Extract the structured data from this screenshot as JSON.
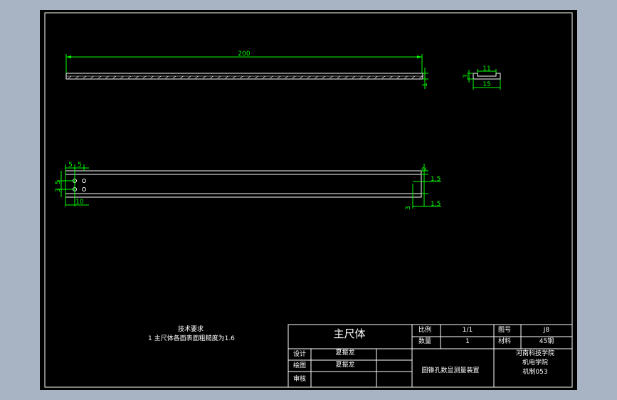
{
  "drawing": {
    "top_view": {
      "length_dim": "200",
      "end_dim": "1"
    },
    "section_view": {
      "width_dim": "15",
      "slot_dim": "11",
      "height_dim": "3"
    },
    "front_view": {
      "left_dims": {
        "top_a": "5",
        "top_b": "5",
        "side_a": "3",
        "side_b": "5",
        "bottom": "10"
      },
      "right_dims": {
        "d1": "2",
        "d2": "1.5",
        "d3": "3",
        "d4": "1.5"
      }
    },
    "notes": {
      "heading": "技术要求",
      "item_1": "1  主尺体各面表面粗糙度为1.6"
    },
    "title_block": {
      "part_name": "主尺体",
      "scale_label": "比例",
      "scale_value": "1/1",
      "drawing_no_label": "图号",
      "drawing_no_value": "J8",
      "qty_label": "数量",
      "qty_value": "1",
      "material_label": "材料",
      "material_value": "45钢",
      "design_label": "设计",
      "design_name": "夏振龙",
      "draw_label": "绘图",
      "draw_name": "夏振龙",
      "review_label": "审核",
      "assembly_name": "圆锥孔数显测量装置",
      "school_line1": "河南科技学院",
      "school_line2": "机电学院",
      "class_name": "机制053"
    }
  },
  "colors": {
    "paper": "#000000",
    "outline": "#ffffff",
    "dimension": "#00ff00",
    "frame_bg": "#a8b4c4"
  }
}
